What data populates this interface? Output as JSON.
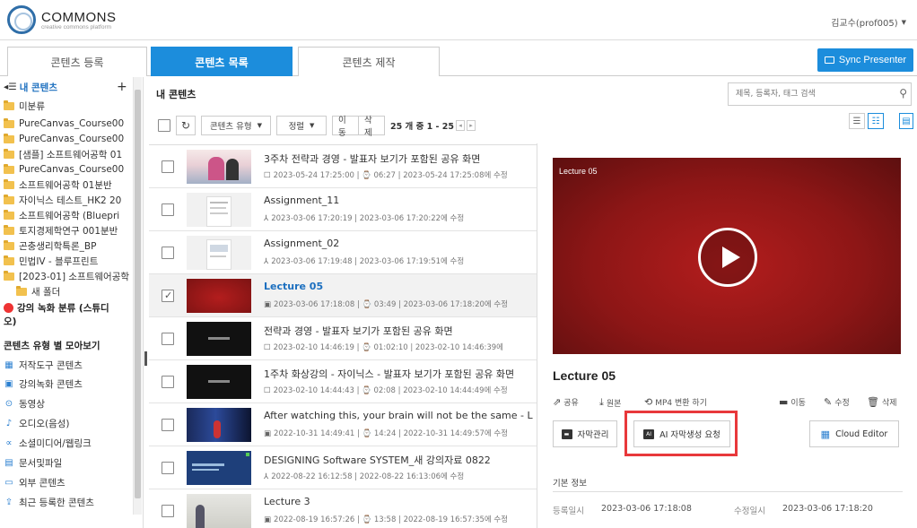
{
  "header": {
    "logo_title": "COMMONS",
    "logo_sub": "creative commons platform",
    "user": "김교수(prof005)"
  },
  "tabs": [
    {
      "label": "콘텐츠 등록",
      "active": false
    },
    {
      "label": "콘텐츠 목록",
      "active": true
    },
    {
      "label": "콘텐츠 제작",
      "active": false
    }
  ],
  "sync_button": "Sync Presenter",
  "sidebar": {
    "root": "내 콘텐츠",
    "add": "+",
    "folders": [
      "미분류",
      "PureCanvas_Course00",
      "PureCanvas_Course00",
      "[샘플] 소프트웨어공학 01",
      "PureCanvas_Course00",
      "소프트웨어공학 01분반",
      "자이닉스 테스트_HK2 20",
      "소프트웨어공학 (Bluepri",
      "토지경제학연구 001분반",
      "곤충생리학특론_BP",
      "민법IV - 블루프린트",
      "[2023-01] 소프트웨어공학",
      "새 폴더"
    ],
    "studio_line1": "강의 녹화 분류 (스튜디",
    "studio_line2": "오)",
    "types_header": "콘텐츠 유형 별 모아보기",
    "types": [
      {
        "icon": "authoring-tool-icon",
        "label": "저작도구 콘텐츠"
      },
      {
        "icon": "lecture-record-icon",
        "label": "강의녹화 콘텐츠"
      },
      {
        "icon": "video-icon",
        "label": "동영상"
      },
      {
        "icon": "audio-icon",
        "label": "오디오(음성)"
      },
      {
        "icon": "share-icon",
        "label": "소셜미디어/웹링크"
      },
      {
        "icon": "document-icon",
        "label": "문서및파일"
      },
      {
        "icon": "external-icon",
        "label": "외부 콘텐츠"
      },
      {
        "icon": "upload-icon",
        "label": "최근 등록한 콘텐츠"
      }
    ]
  },
  "list": {
    "title": "내 콘텐츠",
    "type_filter": "콘텐츠 유형",
    "sort": "정렬",
    "move": "이동",
    "delete": "삭제",
    "pager": "25 개 중 1 - 25",
    "rows": [
      {
        "title": "3주차 전략과 경영 - 발표자 보기가 포함된 공유 화면",
        "meta": "2023-05-24 17:25:00 | ⌚ 06:27 | 2023-05-24 17:25:08에 수정",
        "icon": "☐",
        "selected": false
      },
      {
        "title": "Assignment_11",
        "meta": "2023-03-06 17:20:19 | 2023-03-06 17:20:22에 수정",
        "icon": "⅄",
        "selected": false
      },
      {
        "title": "Assignment_02",
        "meta": "2023-03-06 17:19:48 | 2023-03-06 17:19:51에 수정",
        "icon": "⅄",
        "selected": false
      },
      {
        "title": "Lecture 05",
        "meta": "2023-03-06 17:18:08 | ⌚ 03:49 | 2023-03-06 17:18:20에 수정",
        "icon": "▣",
        "selected": true
      },
      {
        "title": "전략과 경영 - 발표자 보기가 포함된 공유 화면",
        "meta": "2023-02-10 14:46:19 | ⌚ 01:02:10 | 2023-02-10 14:46:39에",
        "icon": "☐",
        "selected": false
      },
      {
        "title": "1주차 화상강의 - 자이닉스 - 발표자 보기가 포함된 공유 화면",
        "meta": "2023-02-10 14:44:43 | ⌚ 02:08 | 2023-02-10 14:44:49에 수정",
        "icon": "☐",
        "selected": false
      },
      {
        "title": "After watching this, your brain will not be the same - Lara",
        "meta": "2022-10-31 14:49:41 | ⌚ 14:24 | 2022-10-31 14:49:57에 수정",
        "icon": "▣",
        "selected": false
      },
      {
        "title": "DESIGNING Software SYSTEM_새 강의자료 0822",
        "meta": "2022-08-22 16:12:58 | 2022-08-22 16:13:06에 수정",
        "icon": "⅄",
        "selected": false
      },
      {
        "title": "Lecture 3",
        "meta": "2022-08-19 16:57:26 | ⌚ 13:58 | 2022-08-19 16:57:35에 수정",
        "icon": "▣",
        "selected": false
      }
    ]
  },
  "search": {
    "placeholder": "제목, 등록자, 태그 검색"
  },
  "detail": {
    "video_label": "Lecture 05",
    "title": "Lecture 05",
    "actions": {
      "share": "공유",
      "original": "원본",
      "mp4": "MP4 변환 하기",
      "move": "이동",
      "edit": "수정",
      "delete": "삭제"
    },
    "subtitle_manage": "자막관리",
    "ai_subtitle": "AI 자막생성 요청",
    "cloud_editor": "Cloud Editor",
    "info_title": "기본 정보",
    "reg_label": "등록일시",
    "reg_value": "2023-03-06 17:18:08",
    "mod_label": "수정일시",
    "mod_value": "2023-03-06 17:18:20"
  },
  "colors": {
    "accent": "#1c8ddc",
    "highlight": "#e8383b",
    "folder": "#f2c14e"
  }
}
